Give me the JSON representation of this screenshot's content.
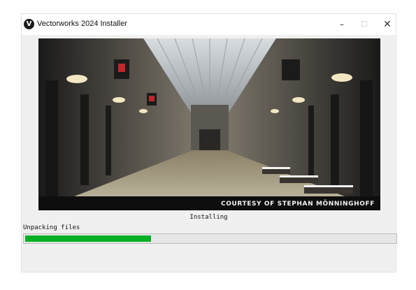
{
  "window": {
    "title": "Vectorworks 2024 Installer",
    "app_icon": "vectorworks-logo-icon",
    "controls": {
      "minimize": "–",
      "maximize": "☐",
      "close": "✕"
    }
  },
  "banner": {
    "image": "shopping-arcade-interior-rendering",
    "credit": "COURTESY OF STEPHAN MÖNNINGHOFF"
  },
  "install": {
    "status_label": "Installing",
    "detail_label": "Unpacking files",
    "progress_fraction": 0.34
  },
  "colors": {
    "progress_fill": "#06b025",
    "window_bg": "#f0f0f0"
  }
}
